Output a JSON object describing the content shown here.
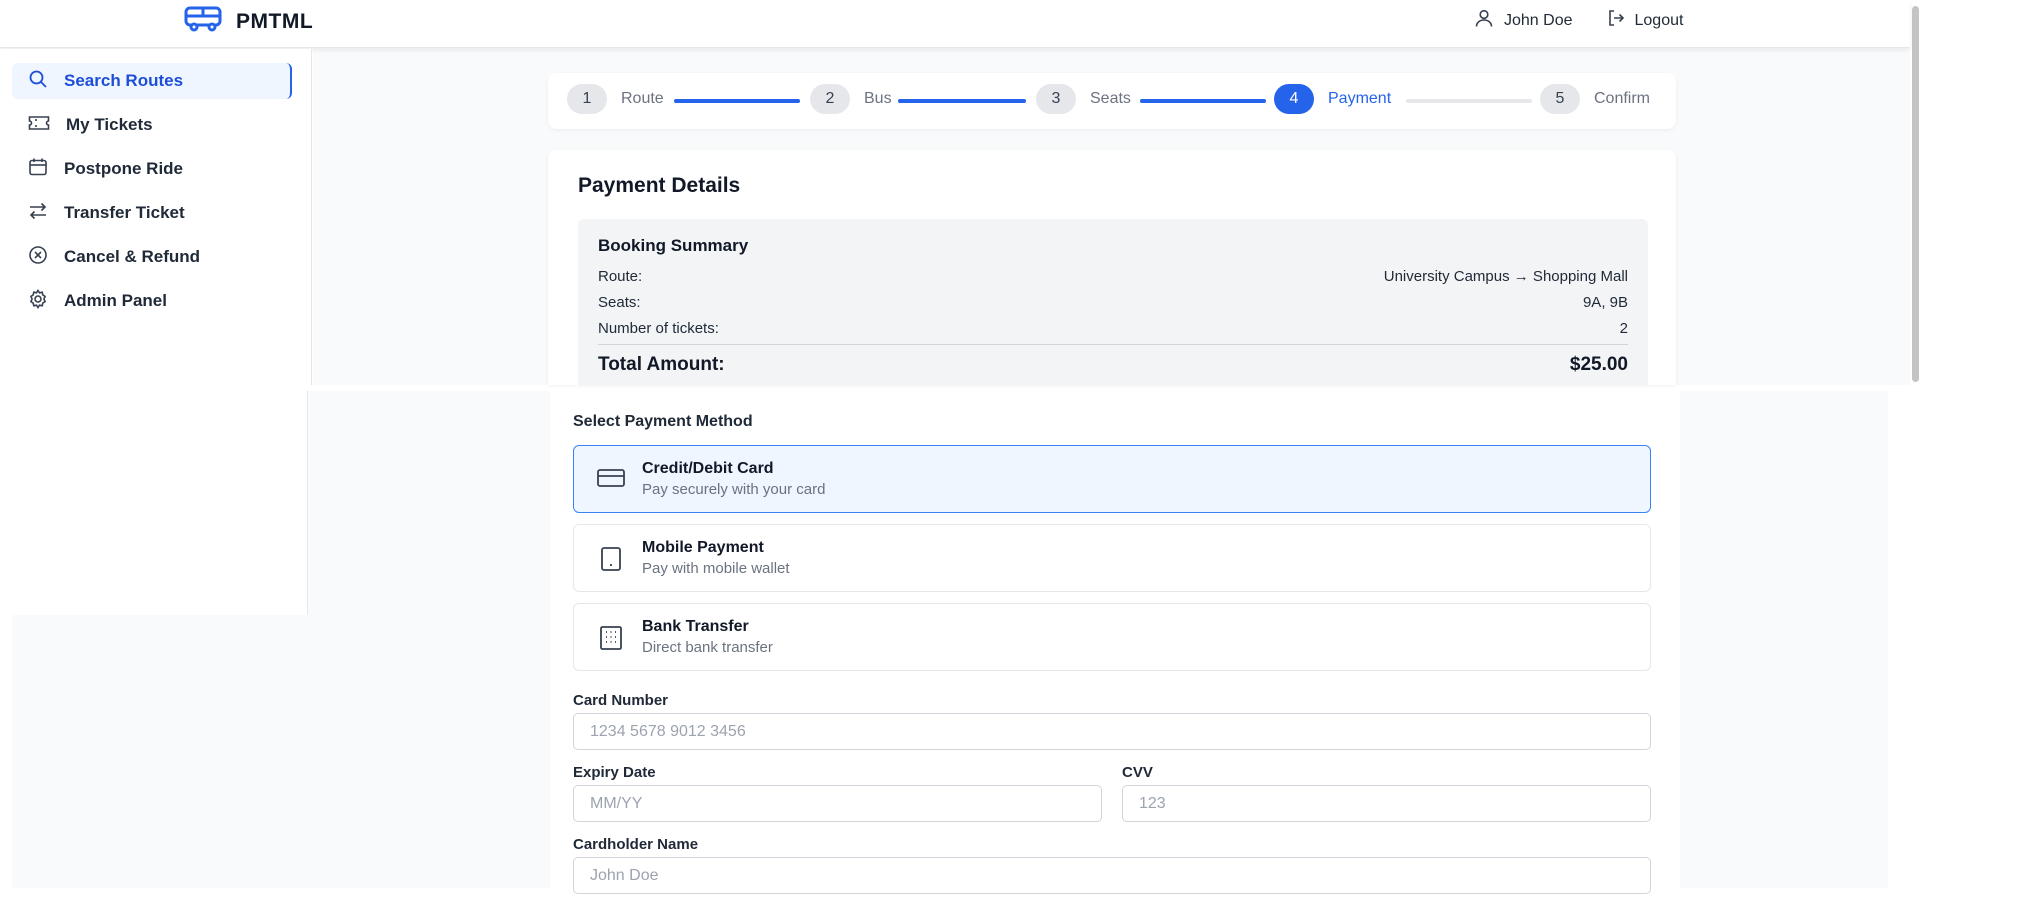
{
  "header": {
    "brand": "PMTML",
    "user_name": "John Doe",
    "logout_label": "Logout",
    "icons": [
      "bus-icon",
      "user-icon",
      "logout-icon"
    ]
  },
  "sidebar": {
    "items": [
      {
        "label": "Search Routes",
        "icon": "search-icon",
        "active": true
      },
      {
        "label": "My Tickets",
        "icon": "ticket-icon",
        "active": false
      },
      {
        "label": "Postpone Ride",
        "icon": "calendar-icon",
        "active": false
      },
      {
        "label": "Transfer Ticket",
        "icon": "transfer-icon",
        "active": false
      },
      {
        "label": "Cancel & Refund",
        "icon": "cancel-circle-icon",
        "active": false
      },
      {
        "label": "Admin Panel",
        "icon": "gear-icon",
        "active": false
      }
    ]
  },
  "stepper": {
    "current_step": 4,
    "steps": [
      {
        "num": "1",
        "label": "Route",
        "status": "complete"
      },
      {
        "num": "2",
        "label": "Bus",
        "status": "complete"
      },
      {
        "num": "3",
        "label": "Seats",
        "status": "complete"
      },
      {
        "num": "4",
        "label": "Payment",
        "status": "active"
      },
      {
        "num": "5",
        "label": "Confirm",
        "status": "pending"
      }
    ]
  },
  "payment": {
    "title": "Payment Details",
    "summary": {
      "title": "Booking Summary",
      "rows": [
        {
          "label": "Route:",
          "value": "University Campus → Shopping Mall"
        },
        {
          "label": "Seats:",
          "value": "9A, 9B"
        },
        {
          "label": "Number of tickets:",
          "value": "2"
        }
      ],
      "total_label": "Total Amount:",
      "total_value": "$25.00"
    },
    "method_label": "Select Payment Method",
    "methods": [
      {
        "name": "Credit/Debit Card",
        "desc": "Pay securely with your card",
        "icon": "credit-card-icon",
        "selected": true
      },
      {
        "name": "Mobile Payment",
        "desc": "Pay with mobile wallet",
        "icon": "smartphone-icon",
        "selected": false
      },
      {
        "name": "Bank Transfer",
        "desc": "Direct bank transfer",
        "icon": "bank-building-icon",
        "selected": false
      }
    ],
    "form": {
      "card_number_label": "Card Number",
      "card_number_placeholder": "1234 5678 9012 3456",
      "card_number_value": "",
      "expiry_label": "Expiry Date",
      "expiry_placeholder": "MM/YY",
      "expiry_value": "",
      "cvv_label": "CVV",
      "cvv_placeholder": "123",
      "cvv_value": "",
      "holder_label": "Cardholder Name",
      "holder_placeholder": "John Doe",
      "holder_value": ""
    }
  },
  "colors": {
    "accent": "#2563eb",
    "active_bg": "#eff6ff",
    "page_bg": "#f9fafb",
    "muted_text": "#6b7280"
  }
}
